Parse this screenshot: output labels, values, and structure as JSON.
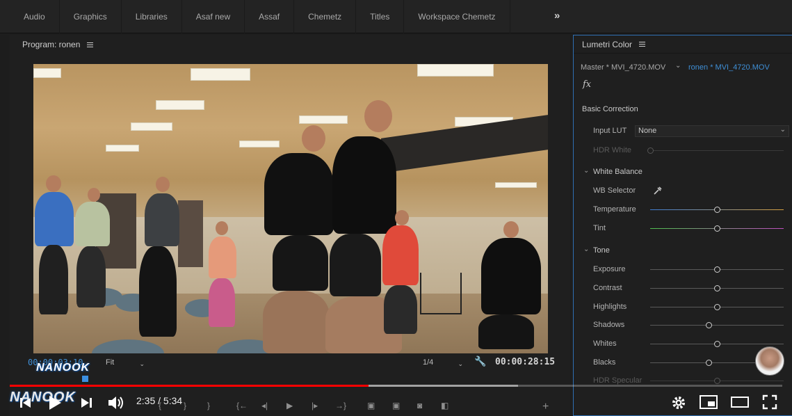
{
  "workspaces": [
    "Audio",
    "Graphics",
    "Libraries",
    "Asaf new",
    "Assaf",
    "Chemetz",
    "Titles",
    "Workspace Chemetz"
  ],
  "workspace_overflow": "»",
  "program_monitor": {
    "title": "Program: ronen",
    "current_timecode": "00:00:03:10",
    "fit_option": "Fit",
    "resolution": "1/4",
    "duration_timecode": "00:00:28:15"
  },
  "lumetri": {
    "title": "Lumetri Color",
    "master_clip": "Master * MVI_4720.MOV",
    "sequence_clip": "ronen * MVI_4720.MOV",
    "fx_label": "fx",
    "basic_correction": "Basic Correction",
    "input_lut_label": "Input LUT",
    "input_lut_value": "None",
    "hdr_white": "HDR White",
    "white_balance": "White Balance",
    "wb_selector": "WB Selector",
    "temperature": "Temperature",
    "tint": "Tint",
    "tone": "Tone",
    "exposure": "Exposure",
    "contrast": "Contrast",
    "highlights": "Highlights",
    "shadows": "Shadows",
    "whites": "Whites",
    "blacks": "Blacks",
    "hdr_specular": "HDR Specular"
  },
  "youtube": {
    "time_display": "2:35 / 5:34",
    "played_fraction": 0.464,
    "buffered_fraction": 0.658
  },
  "watermark": "NANOOK",
  "colors": {
    "accent_blue": "#3f8fd6",
    "progress_red": "#ff0000"
  },
  "icons": {
    "menu": "hamburger-icon",
    "eyedropper": "eyedropper-icon",
    "wrench": "wrench-icon"
  }
}
